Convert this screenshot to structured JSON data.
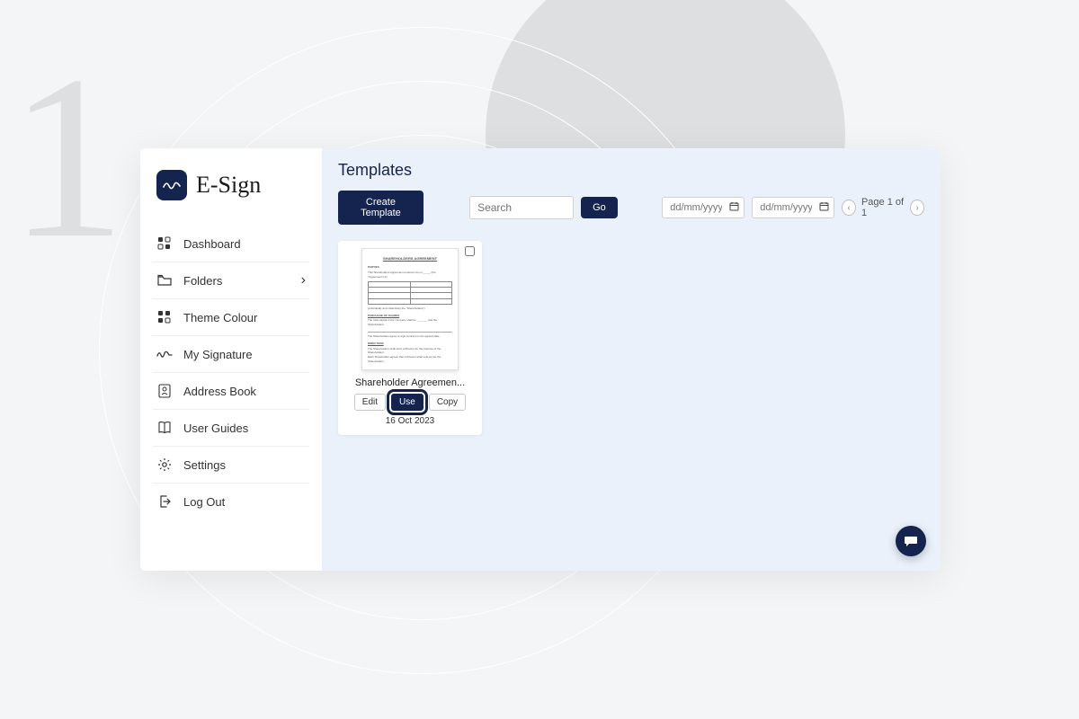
{
  "bg_number": "1",
  "brand": "E-Sign",
  "sidebar": {
    "items": [
      {
        "label": "Dashboard"
      },
      {
        "label": "Folders"
      },
      {
        "label": "Theme Colour"
      },
      {
        "label": "My Signature"
      },
      {
        "label": "Address Book"
      },
      {
        "label": "User Guides"
      },
      {
        "label": "Settings"
      },
      {
        "label": "Log Out"
      }
    ]
  },
  "main": {
    "title": "Templates",
    "create_label": "Create Template",
    "search_placeholder": "Search",
    "go_label": "Go",
    "date_placeholder": "dd/mm/yyyy",
    "pager_text": "Page 1 of 1"
  },
  "template": {
    "doc_heading": "SHAREHOLDERS AGREEMENT",
    "title": "Shareholder Agreemen...",
    "edit": "Edit",
    "use": "Use",
    "copy": "Copy",
    "date": "16 Oct 2023"
  }
}
